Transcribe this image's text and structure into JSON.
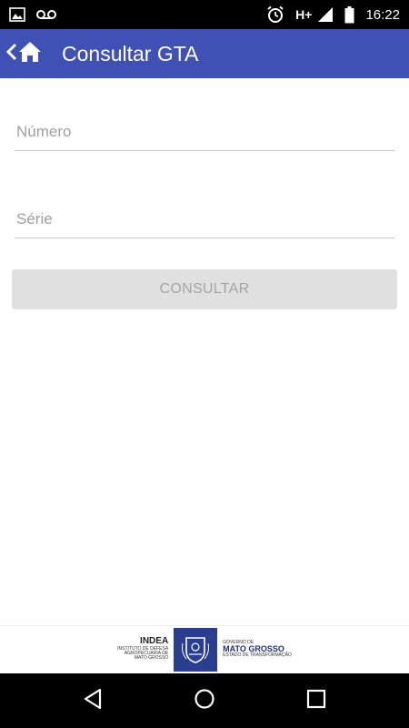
{
  "status_bar": {
    "network": "H+",
    "time": "16:22",
    "icons": [
      "image-icon",
      "voicemail-icon",
      "alarm-icon",
      "signal-icon",
      "battery-icon"
    ]
  },
  "app_bar": {
    "title": "Consultar GTA",
    "color": "#3f51b5"
  },
  "form": {
    "numero_placeholder": "Número",
    "numero_value": "",
    "serie_placeholder": "Série",
    "serie_value": "",
    "consult_label": "CONSULTAR"
  },
  "footer": {
    "indea_title": "INDEA",
    "indea_line1": "INSTITUTO DE DEFESA",
    "indea_line2": "AGROPECUÁRIA DE",
    "indea_line3": "MATO GROSSO",
    "gov_line1": "GOVERNO DE",
    "gov_title": "MATO GROSSO",
    "gov_line2": "ESTADO DE TRANSFORMAÇÃO"
  },
  "nav_bar": {
    "icons": [
      "back-icon",
      "home-circle-icon",
      "recents-icon"
    ]
  }
}
